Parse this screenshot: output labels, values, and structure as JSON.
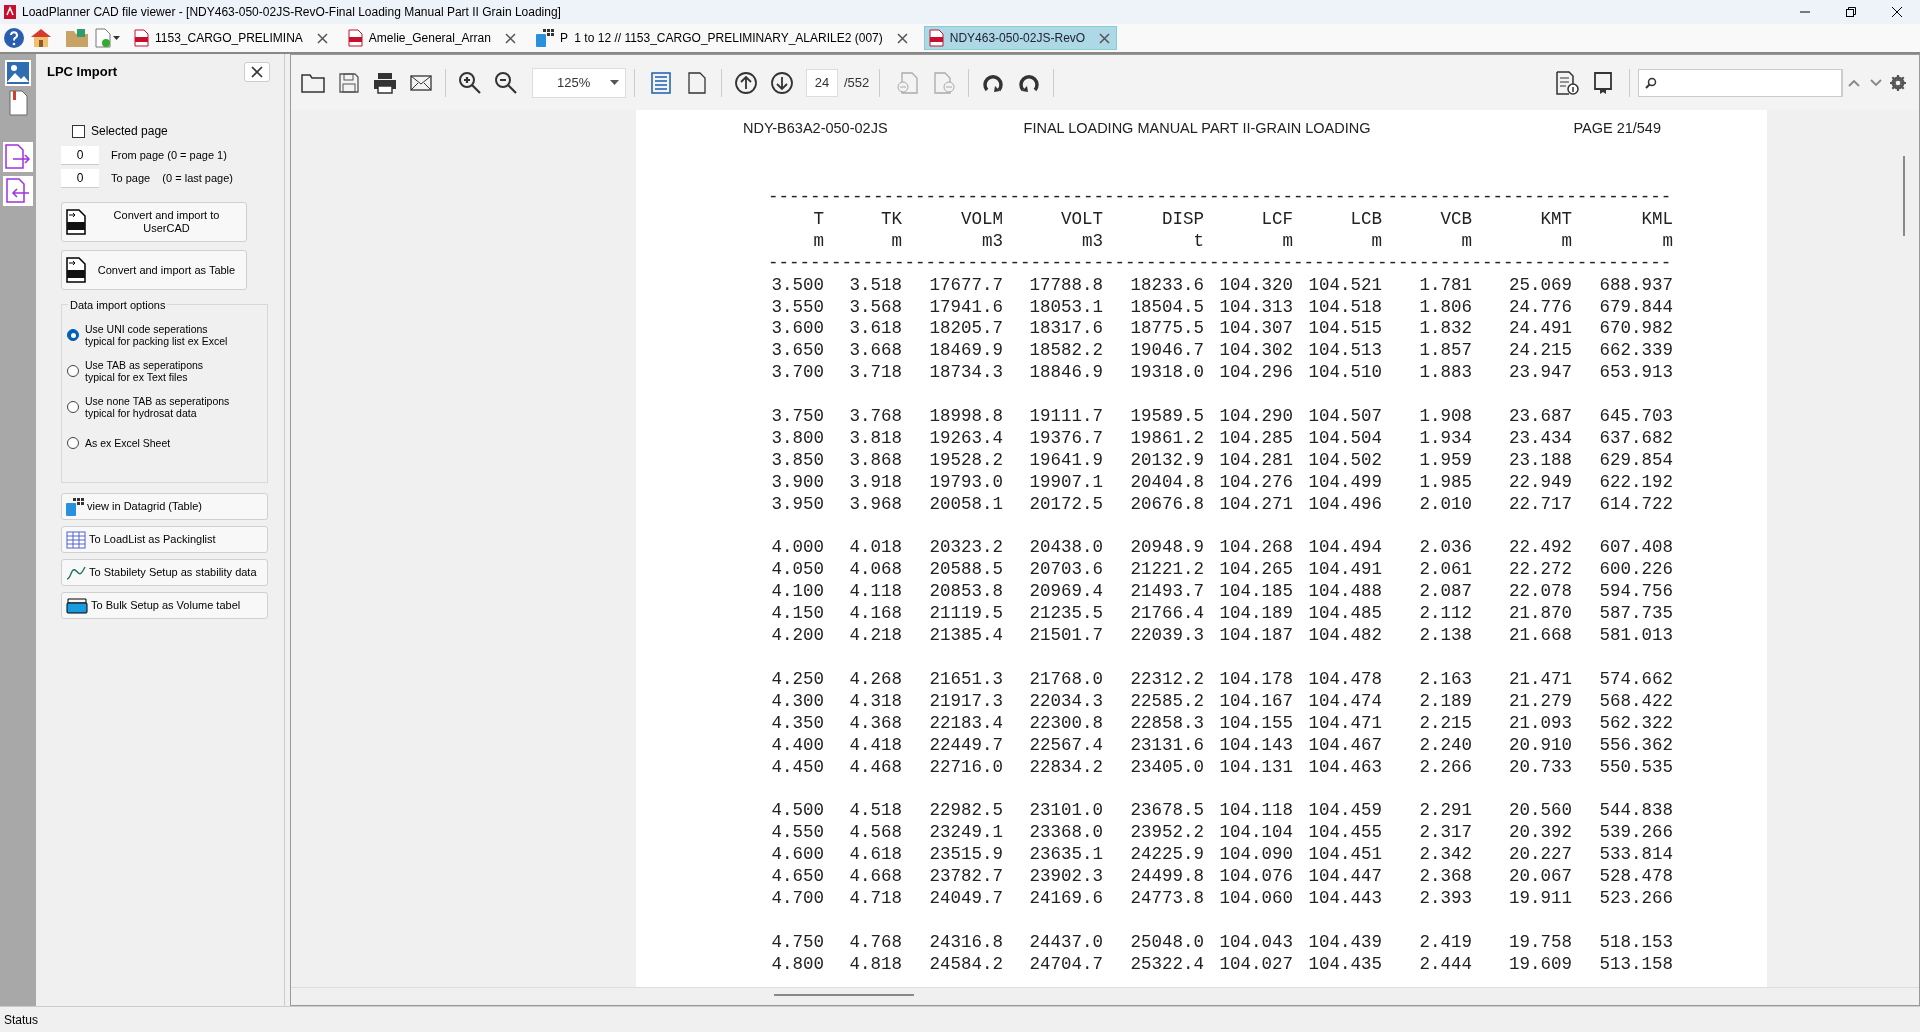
{
  "window": {
    "title": "LoadPlanner CAD file viewer - [NDY463-050-02JS-RevO-Final Loading Manual Part II Grain Loading]"
  },
  "tabs": [
    {
      "kind": "pdf",
      "label": "1153_CARGO_PRELIMINA",
      "selected": false
    },
    {
      "kind": "pdf",
      "label": "Amelie_General_Arran",
      "selected": false
    },
    {
      "kind": "grid",
      "label": "P  1 to 12 // 1153_CARGO_PRELIMINARY_ALARILE2 (007)",
      "selected": false
    },
    {
      "kind": "pdf",
      "label": "NDY463-050-02JS-RevO",
      "selected": true
    }
  ],
  "toolbar": {
    "zoom": "125%",
    "page": "24",
    "page_count": "/552"
  },
  "panel": {
    "title": "LPC Import",
    "selected_page": {
      "label": "Selected page",
      "checked": false
    },
    "page_fields": [
      {
        "value": "0",
        "label": "From page (0 = page 1)"
      },
      {
        "value": "0",
        "label": "To page    (0 = last page)"
      }
    ],
    "convert_buttons": [
      {
        "lines": [
          "Convert and import to",
          "UserCAD"
        ]
      },
      {
        "lines": [
          "Convert and import as Table"
        ]
      }
    ],
    "options_title": "Data import options",
    "options": [
      {
        "lines": [
          "Use UNI code seperations",
          "typical for packing list ex Excel"
        ],
        "selected": true
      },
      {
        "lines": [
          "Use TAB as seperatipons",
          "typical for ex Text files"
        ],
        "selected": false
      },
      {
        "lines": [
          "Use none TAB as seperatipons",
          "typical for hydrosat data"
        ],
        "selected": false
      },
      {
        "lines": [
          "As ex Excel Sheet"
        ],
        "selected": false
      }
    ],
    "actions": [
      {
        "kind": "datagrid",
        "label": "view in Datagrid (Table)"
      },
      {
        "kind": "table",
        "label": "To LoadList as Packinglist"
      },
      {
        "kind": "curve",
        "label": "To Stabilety Setup as stability data"
      },
      {
        "kind": "tray",
        "label": "To Bulk Setup as Volume tabel"
      }
    ]
  },
  "document": {
    "header_left": "NDY-B63A2-050-02JS",
    "header_center": "FINAL LOADING MANUAL PART II-GRAIN LOADING",
    "header_right": "PAGE 21/549",
    "rule_top": "--------------------------------------------------------------------------------------",
    "rule_bottom": "--------------------------------------------------------------------------------------",
    "columns": [
      {
        "name": "T",
        "unit": "m"
      },
      {
        "name": "TK",
        "unit": "m"
      },
      {
        "name": "VOLM",
        "unit": "m3"
      },
      {
        "name": "VOLT",
        "unit": "m3"
      },
      {
        "name": "DISP",
        "unit": "t"
      },
      {
        "name": "LCF",
        "unit": "m"
      },
      {
        "name": "LCB",
        "unit": "m"
      },
      {
        "name": "VCB",
        "unit": "m"
      },
      {
        "name": "KMT",
        "unit": "m"
      },
      {
        "name": "KML",
        "unit": "m"
      }
    ],
    "groups": [
      [
        [
          "3.500",
          "3.518",
          "17677.7",
          "17788.8",
          "18233.6",
          "104.320",
          "104.521",
          "1.781",
          "25.069",
          "688.937"
        ],
        [
          "3.550",
          "3.568",
          "17941.6",
          "18053.1",
          "18504.5",
          "104.313",
          "104.518",
          "1.806",
          "24.776",
          "679.844"
        ],
        [
          "3.600",
          "3.618",
          "18205.7",
          "18317.6",
          "18775.5",
          "104.307",
          "104.515",
          "1.832",
          "24.491",
          "670.982"
        ],
        [
          "3.650",
          "3.668",
          "18469.9",
          "18582.2",
          "19046.7",
          "104.302",
          "104.513",
          "1.857",
          "24.215",
          "662.339"
        ],
        [
          "3.700",
          "3.718",
          "18734.3",
          "18846.9",
          "19318.0",
          "104.296",
          "104.510",
          "1.883",
          "23.947",
          "653.913"
        ]
      ],
      [
        [
          "3.750",
          "3.768",
          "18998.8",
          "19111.7",
          "19589.5",
          "104.290",
          "104.507",
          "1.908",
          "23.687",
          "645.703"
        ],
        [
          "3.800",
          "3.818",
          "19263.4",
          "19376.7",
          "19861.2",
          "104.285",
          "104.504",
          "1.934",
          "23.434",
          "637.682"
        ],
        [
          "3.850",
          "3.868",
          "19528.2",
          "19641.9",
          "20132.9",
          "104.281",
          "104.502",
          "1.959",
          "23.188",
          "629.854"
        ],
        [
          "3.900",
          "3.918",
          "19793.0",
          "19907.1",
          "20404.8",
          "104.276",
          "104.499",
          "1.985",
          "22.949",
          "622.192"
        ],
        [
          "3.950",
          "3.968",
          "20058.1",
          "20172.5",
          "20676.8",
          "104.271",
          "104.496",
          "2.010",
          "22.717",
          "614.722"
        ]
      ],
      [
        [
          "4.000",
          "4.018",
          "20323.2",
          "20438.0",
          "20948.9",
          "104.268",
          "104.494",
          "2.036",
          "22.492",
          "607.408"
        ],
        [
          "4.050",
          "4.068",
          "20588.5",
          "20703.6",
          "21221.2",
          "104.265",
          "104.491",
          "2.061",
          "22.272",
          "600.226"
        ],
        [
          "4.100",
          "4.118",
          "20853.8",
          "20969.4",
          "21493.7",
          "104.185",
          "104.488",
          "2.087",
          "22.078",
          "594.756"
        ],
        [
          "4.150",
          "4.168",
          "21119.5",
          "21235.5",
          "21766.4",
          "104.189",
          "104.485",
          "2.112",
          "21.870",
          "587.735"
        ],
        [
          "4.200",
          "4.218",
          "21385.4",
          "21501.7",
          "22039.3",
          "104.187",
          "104.482",
          "2.138",
          "21.668",
          "581.013"
        ]
      ],
      [
        [
          "4.250",
          "4.268",
          "21651.3",
          "21768.0",
          "22312.2",
          "104.178",
          "104.478",
          "2.163",
          "21.471",
          "574.662"
        ],
        [
          "4.300",
          "4.318",
          "21917.3",
          "22034.3",
          "22585.2",
          "104.167",
          "104.474",
          "2.189",
          "21.279",
          "568.422"
        ],
        [
          "4.350",
          "4.368",
          "22183.4",
          "22300.8",
          "22858.3",
          "104.155",
          "104.471",
          "2.215",
          "21.093",
          "562.322"
        ],
        [
          "4.400",
          "4.418",
          "22449.7",
          "22567.4",
          "23131.6",
          "104.143",
          "104.467",
          "2.240",
          "20.910",
          "556.362"
        ],
        [
          "4.450",
          "4.468",
          "22716.0",
          "22834.2",
          "23405.0",
          "104.131",
          "104.463",
          "2.266",
          "20.733",
          "550.535"
        ]
      ],
      [
        [
          "4.500",
          "4.518",
          "22982.5",
          "23101.0",
          "23678.5",
          "104.118",
          "104.459",
          "2.291",
          "20.560",
          "544.838"
        ],
        [
          "4.550",
          "4.568",
          "23249.1",
          "23368.0",
          "23952.2",
          "104.104",
          "104.455",
          "2.317",
          "20.392",
          "539.266"
        ],
        [
          "4.600",
          "4.618",
          "23515.9",
          "23635.1",
          "24225.9",
          "104.090",
          "104.451",
          "2.342",
          "20.227",
          "533.814"
        ],
        [
          "4.650",
          "4.668",
          "23782.7",
          "23902.3",
          "24499.8",
          "104.076",
          "104.447",
          "2.368",
          "20.067",
          "528.478"
        ],
        [
          "4.700",
          "4.718",
          "24049.7",
          "24169.6",
          "24773.8",
          "104.060",
          "104.443",
          "2.393",
          "19.911",
          "523.266"
        ]
      ],
      [
        [
          "4.750",
          "4.768",
          "24316.8",
          "24437.0",
          "25048.0",
          "104.043",
          "104.439",
          "2.419",
          "19.758",
          "518.153"
        ],
        [
          "4.800",
          "4.818",
          "24584.2",
          "24704.7",
          "25322.4",
          "104.027",
          "104.435",
          "2.444",
          "19.609",
          "513.158"
        ]
      ]
    ]
  },
  "status_bar": {
    "text": "Status"
  }
}
